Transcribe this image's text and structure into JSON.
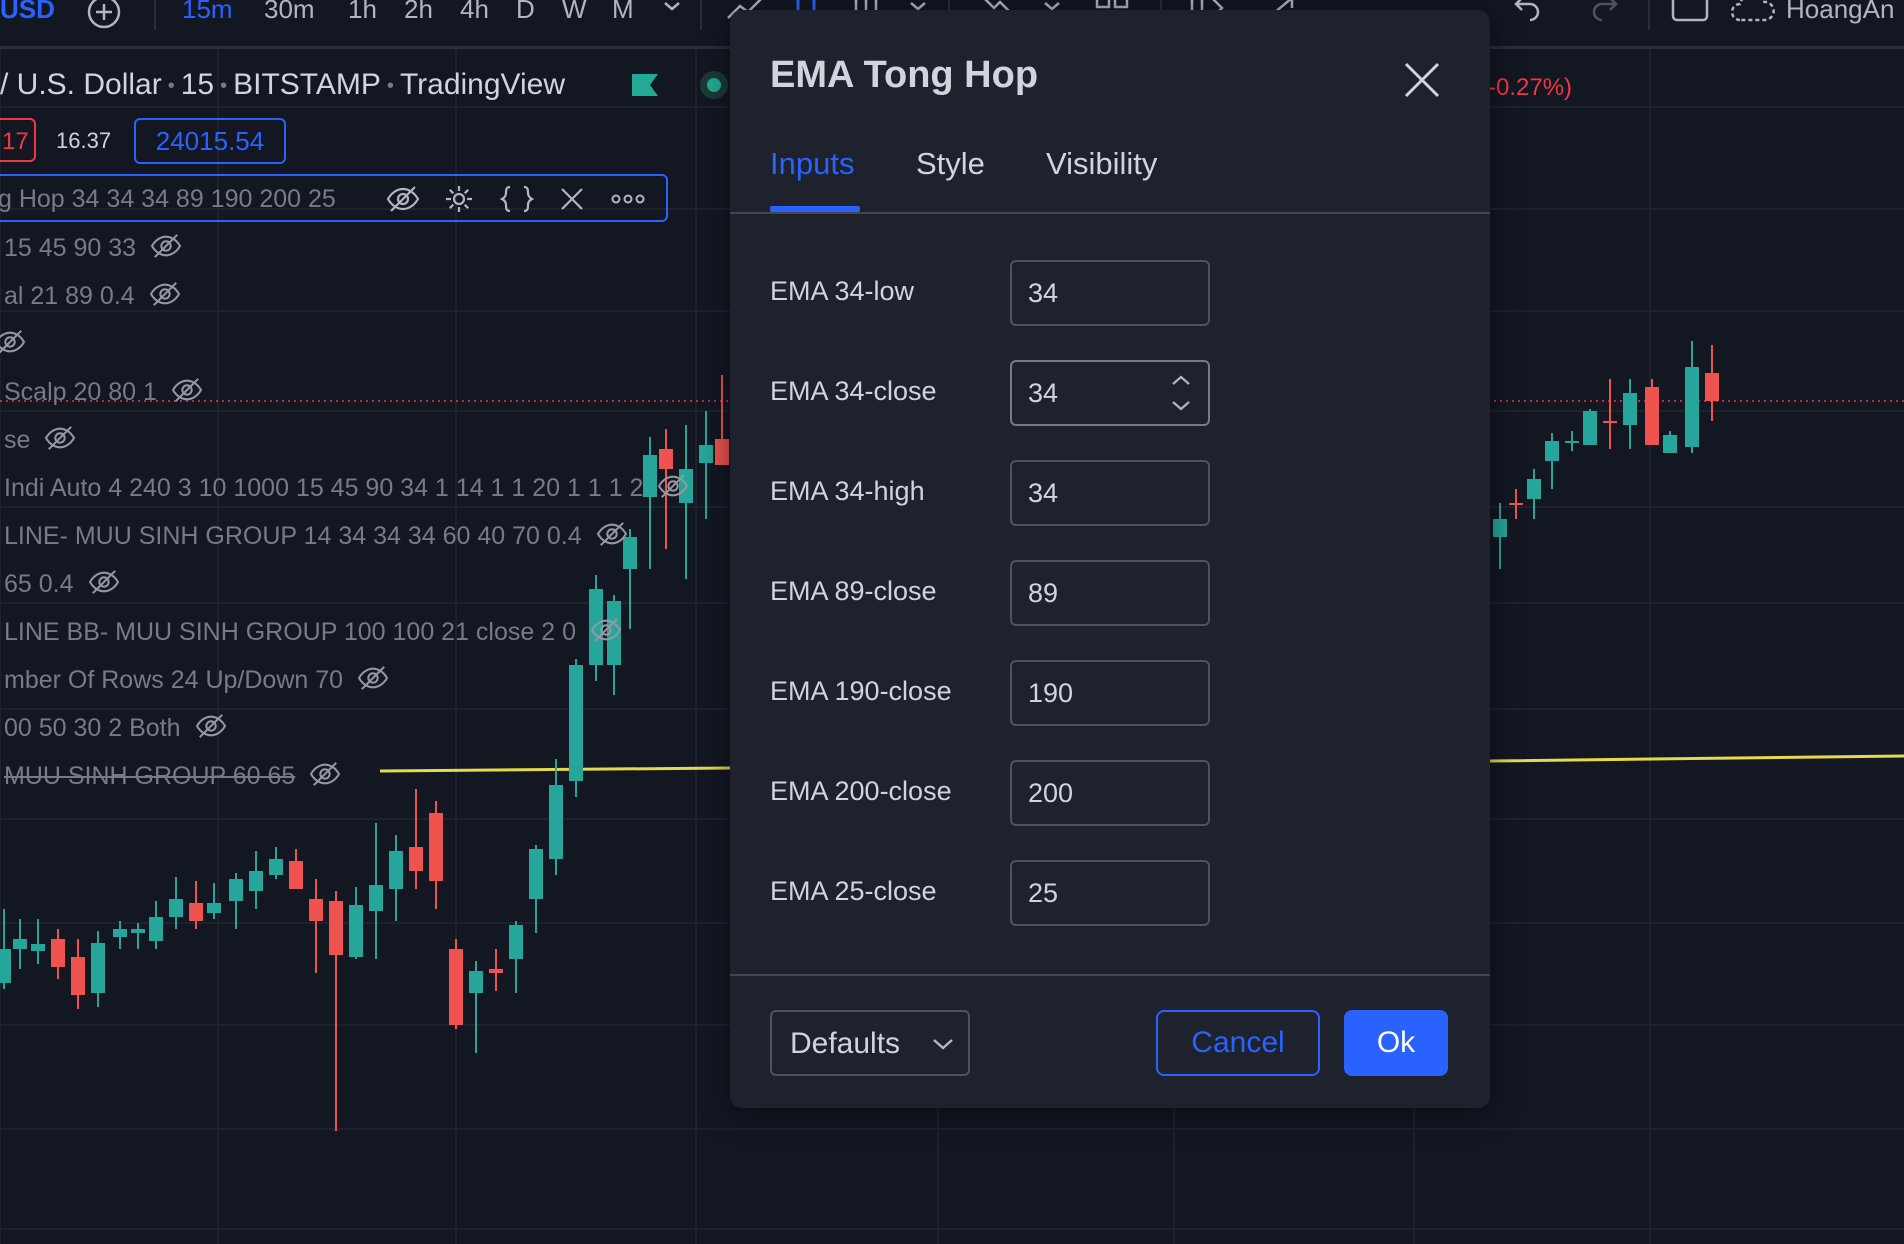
{
  "toolbar": {
    "symbol": "USD",
    "intervals": [
      "15m",
      "30m",
      "1h",
      "2h",
      "4h",
      "D",
      "W",
      "M"
    ],
    "active_interval": "15m",
    "user": "HoangAn"
  },
  "header": {
    "symbol_name": "/ U.S. Dollar",
    "interval": "15",
    "exchange": "BITSTAMP",
    "source": "TradingView",
    "change_pct": "-0.27%)",
    "price_red": "17",
    "price_mid": "16.37",
    "price_blue": "24015.54"
  },
  "legend": {
    "main_indicator": "g Hop 34 34 34 89 190 200 25",
    "lines": [
      "15 45 90 33",
      "al 21 89 0.4",
      "",
      "Scalp 20 80 1",
      "se",
      "Indi Auto 4 240 3 10 1000 15 45 90 34 1 14 1 1 20 1 1 1 2",
      "LINE- MUU SINH GROUP 14 34 34 34 60 40 70 0.4",
      "65 0.4",
      "LINE BB- MUU SINH GROUP 100 100 21 close 2 0",
      "mber Of Rows 24 Up/Down 70",
      "00 50 30 2 Both",
      "MUU SINH GROUP 60 65"
    ]
  },
  "dialog": {
    "title": "EMA Tong Hop",
    "tabs": [
      "Inputs",
      "Style",
      "Visibility"
    ],
    "active_tab": "Inputs",
    "inputs": [
      {
        "label": "EMA 34-low",
        "value": "34"
      },
      {
        "label": "EMA 34-close",
        "value": "34"
      },
      {
        "label": "EMA 34-high",
        "value": "34"
      },
      {
        "label": "EMA 89-close",
        "value": "89"
      },
      {
        "label": "EMA 190-close",
        "value": "190"
      },
      {
        "label": "EMA 200-close",
        "value": "200"
      },
      {
        "label": "EMA 25-close",
        "value": "25"
      }
    ],
    "defaults_label": "Defaults",
    "cancel_label": "Cancel",
    "ok_label": "Ok"
  },
  "colors": {
    "background": "#131722",
    "dialog_bg": "#1e222d",
    "accent": "#2962ff",
    "up_candle": "#26a69a",
    "down_candle": "#ef5350",
    "ema_line": "#e6d94a"
  }
}
